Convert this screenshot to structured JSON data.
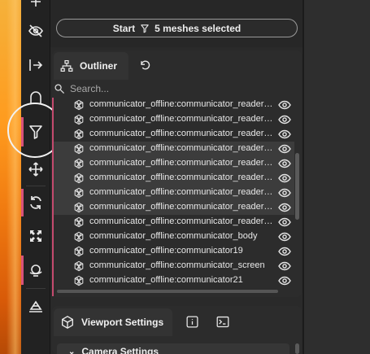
{
  "toolbar": {
    "tools": [
      {
        "icon": "grid-icon"
      },
      {
        "icon": "eye-off-icon"
      },
      {
        "icon": "exit-icon"
      },
      {
        "icon": "ghost-icon"
      },
      {
        "icon": "filter-icon"
      },
      {
        "icon": "move-icon"
      },
      {
        "icon": "sync-icon"
      },
      {
        "icon": "expand-icon"
      },
      {
        "icon": "planet-icon"
      },
      {
        "icon": "terrain-icon"
      }
    ],
    "accent_color": "#d9527a"
  },
  "start_bar": {
    "start_label": "Start",
    "selection_label": "5 meshes selected"
  },
  "outliner": {
    "title": "Outliner",
    "search_placeholder": "Search...",
    "items": [
      {
        "name": "communicator_offline:communicator_reader_antenna",
        "selected": false
      },
      {
        "name": "communicator_offline:communicator_reader_base",
        "selected": false
      },
      {
        "name": "communicator_offline:communicator_reader_button",
        "selected": false
      },
      {
        "name": "communicator_offline:communicator_reader_cable",
        "selected": true
      },
      {
        "name": "communicator_offline:communicator_reader_casing",
        "selected": true
      },
      {
        "name": "communicator_offline:communicator_reader_frame",
        "selected": true
      },
      {
        "name": "communicator_offline:communicator_reader_glass",
        "selected": true
      },
      {
        "name": "communicator_offline:communicator_reader_screen",
        "selected": true
      },
      {
        "name": "communicator_offline:communicator_reader_trim",
        "selected": false
      },
      {
        "name": "communicator_offline:communicator_body",
        "selected": false
      },
      {
        "name": "communicator_offline:communicator19",
        "selected": false
      },
      {
        "name": "communicator_offline:communicator_screen",
        "selected": false
      },
      {
        "name": "communicator_offline:communicator21",
        "selected": false
      }
    ]
  },
  "viewport_settings": {
    "title": "Viewport Settings",
    "section_label": "Camera Settings"
  }
}
